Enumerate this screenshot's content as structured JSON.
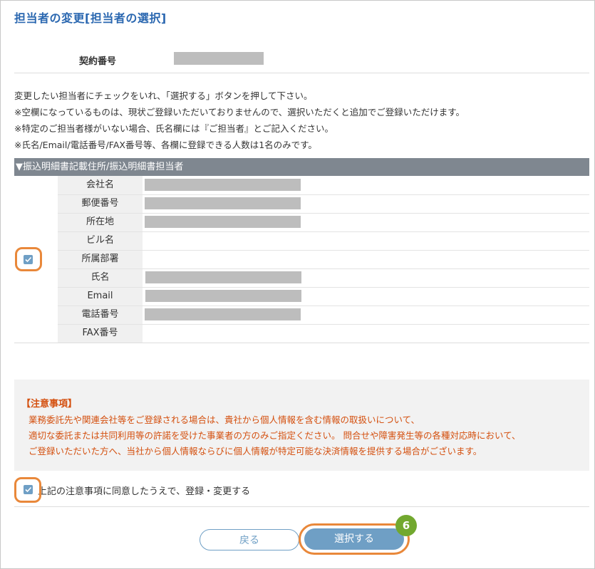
{
  "page": {
    "title": "担当者の変更[担当者の選択]"
  },
  "contract": {
    "label": "契約番号"
  },
  "instructions": [
    "変更したい担当者にチェックをいれ、「選択する」ボタンを押して下さい。",
    "※空欄になっているものは、現状ご登録いただいておりませんので、選択いただくと追加でご登録いただけます。",
    "※特定のご担当者様がいない場合、氏名欄には『ご担当者』とご記入ください。",
    "※氏名/Email/電話番号/FAX番号等、各欄に登録できる人数は1名のみです。"
  ],
  "section": {
    "header": "▼振込明細書記載住所/振込明細書担当者",
    "checkbox_checked": true,
    "fields": [
      {
        "label": "会社名",
        "masked": true
      },
      {
        "label": "郵便番号",
        "masked": true
      },
      {
        "label": "所在地",
        "masked": true
      },
      {
        "label": "ビル名",
        "masked": false
      },
      {
        "label": "所属部署",
        "masked": false
      },
      {
        "label": "氏名",
        "masked": true
      },
      {
        "label": "Email",
        "masked": true
      },
      {
        "label": "電話番号",
        "masked": true
      },
      {
        "label": "FAX番号",
        "masked": false
      }
    ]
  },
  "notice": {
    "title": "【注意事項】",
    "lines": [
      "業務委託先や関連会社等をご登録される場合は、貴社から個人情報を含む情報の取扱いについて、",
      "適切な委託または共同利用等の許諾を受けた事業者の方のみご指定ください。 問合せや障害発生等の各種対応時において、",
      "ご登録いただいた方へ、当社から個人情報ならびに個人情報が特定可能な決済情報を提供する場合がございます。"
    ]
  },
  "agreement": {
    "label": "上記の注意事項に同意したうえで、登録・変更する",
    "checked": true
  },
  "buttons": {
    "back": "戻る",
    "select": "選択する"
  },
  "step_badge": "6",
  "colors": {
    "title": "#2a67b0",
    "header_bg": "#7f8790",
    "accent": "#6f9fc5",
    "highlight": "#e9883a",
    "notice_text": "#d4500f",
    "badge": "#72a82f"
  }
}
